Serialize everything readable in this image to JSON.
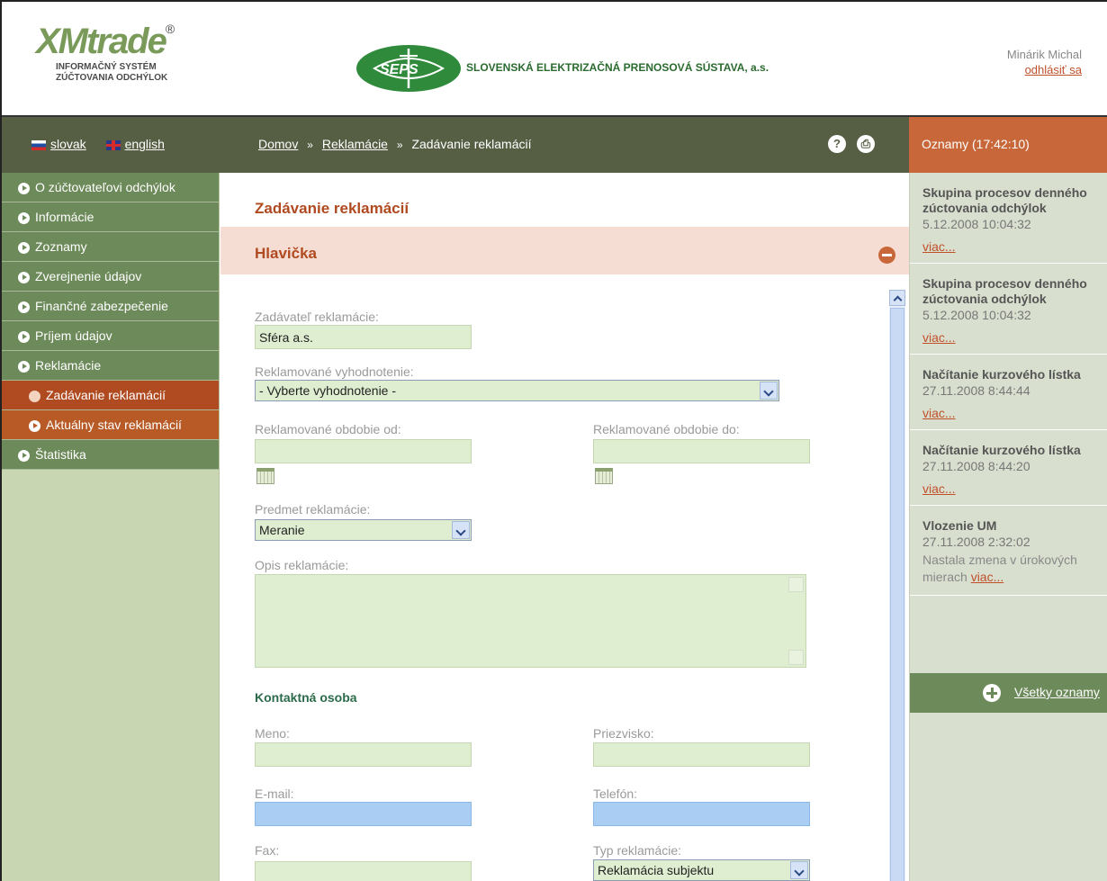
{
  "header": {
    "xm_logo_word": "XMtrade",
    "xm_logo_reg": "®",
    "xm_sub_1": "INFORMAČNÝ SYSTÉM",
    "xm_sub_2": "ZÚČTOVANIA ODCHÝLOK",
    "seps_logo_text": "SEPS",
    "company_name": "SLOVENSKÁ ELEKTRIZAČNÁ PRENOSOVÁ SÚSTAVA, a.s.",
    "user_name": "Minárik Michal",
    "logout_label": "odhlásiť sa"
  },
  "langbar": {
    "slovak": "slovak",
    "english": "english"
  },
  "breadcrumb": {
    "home": "Domov",
    "reklamacie": "Reklamácie",
    "current": "Zadávanie reklamácií",
    "separator": "»"
  },
  "toolbar": {
    "help": "?",
    "print": "⎙"
  },
  "oznamy_header": "Oznamy (17:42:10)",
  "nav": {
    "items": [
      {
        "label": "O zúčtovateľovi odchýlok"
      },
      {
        "label": "Informácie"
      },
      {
        "label": "Zoznamy"
      },
      {
        "label": "Zverejnenie údajov"
      },
      {
        "label": "Finančné zabezpečenie"
      },
      {
        "label": "Príjem údajov"
      },
      {
        "label": "Reklamácie"
      },
      {
        "label": "Zadávanie reklamácií"
      },
      {
        "label": "Aktuálny stav reklamácií"
      },
      {
        "label": "Štatistika"
      }
    ]
  },
  "main": {
    "page_title": "Zadávanie reklamácií",
    "section_title": "Hlavička",
    "form": {
      "zadavatel_label": "Zadávateľ reklamácie:",
      "zadavatel_value": "Sféra a.s.",
      "vyhodnotenie_label": "Reklamované vyhodnotenie:",
      "vyhodnotenie_value": "- Vyberte vyhodnotenie -",
      "obdobie_od_label": "Reklamované obdobie od:",
      "obdobie_do_label": "Reklamované obdobie do:",
      "predmet_label": "Predmet reklamácie:",
      "predmet_value": "Meranie",
      "opis_label": "Opis reklamácie:",
      "kontakt_heading": "Kontaktná osoba",
      "meno_label": "Meno:",
      "priezvisko_label": "Priezvisko:",
      "email_label": "E-mail:",
      "telefon_label": "Telefón:",
      "fax_label": "Fax:",
      "typ_label": "Typ reklamácie:",
      "typ_value": "Reklamácia subjektu"
    }
  },
  "news": [
    {
      "title": "Skupina procesov denného zúctovania odchýlok",
      "date": "5.12.2008 10:04:32",
      "text": "",
      "more": "viac..."
    },
    {
      "title": "Skupina procesov denného zúctovania odchýlok",
      "date": "5.12.2008 10:04:32",
      "text": "",
      "more": "viac..."
    },
    {
      "title": "Načítanie kurzového lístka",
      "date": "27.11.2008 8:44:44",
      "text": "",
      "more": "viac..."
    },
    {
      "title": "Načítanie kurzového lístka",
      "date": "27.11.2008 8:44:20",
      "text": "",
      "more": "viac..."
    },
    {
      "title": "Vlozenie UM",
      "date": "27.11.2008 2:32:02",
      "text": "Nastala zmena v úrokových mierach",
      "more": "viac..."
    }
  ],
  "all_news_label": "Všetky oznamy",
  "colors": {
    "nav_green": "#6d8a5a",
    "nav_active": "#b04a20",
    "accent_orange": "#c8683a",
    "field_green": "#dfeed0",
    "field_blue": "#a9cdf3",
    "bar_dark": "#565f44"
  }
}
